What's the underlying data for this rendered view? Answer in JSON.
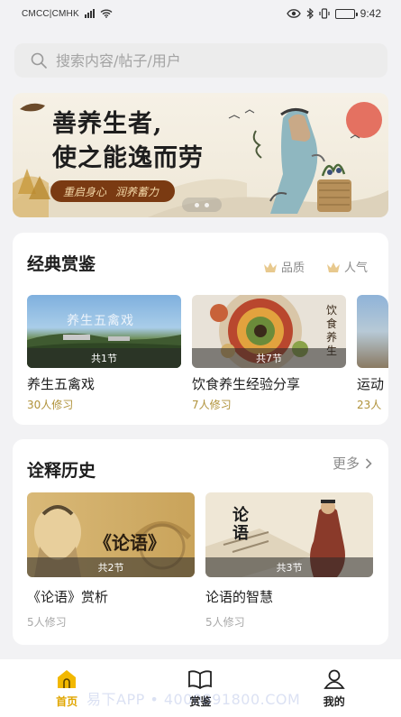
{
  "status": {
    "carrier": "CMCC|CMHK",
    "time": "9:42"
  },
  "search": {
    "placeholder": "搜索内容/帖子/用户"
  },
  "banner": {
    "title_line1": "善养生者,",
    "title_line2": "使之能逸而劳",
    "tag_left": "重启身心",
    "tag_right": "润养蓄力"
  },
  "classics": {
    "title": "经典赏鉴",
    "filters": [
      "品质",
      "人气"
    ],
    "items": [
      {
        "title": "养生五禽戏",
        "image_text": "养生五禽戏",
        "lessons": "共1节",
        "learners": "30人修习"
      },
      {
        "title": "饮食养生经验分享",
        "image_text": "饮食养生",
        "lessons": "共7节",
        "learners": "7人修习"
      },
      {
        "title": "运动",
        "lessons": "",
        "learners": "23人"
      }
    ]
  },
  "history": {
    "title": "诠释历史",
    "more": "更多",
    "items": [
      {
        "title": "《论语》赏析",
        "image_text": "《论语》",
        "lessons": "共2节",
        "learners": "5人修习"
      },
      {
        "title": "论语的智慧",
        "image_text": "论语",
        "lessons": "共3节",
        "learners": "5人修习"
      }
    ]
  },
  "tabbar": {
    "tabs": [
      {
        "label": "首页",
        "icon": "home-icon",
        "active": true
      },
      {
        "label": "赏鉴",
        "icon": "book-icon",
        "active": false
      },
      {
        "label": "我的",
        "icon": "user-icon",
        "active": false
      }
    ]
  },
  "watermark": "易下APP • 4000891800.COM",
  "colors": {
    "accent": "#e0a600",
    "banner_tag": "#7a3a12",
    "learners": "#b0923a"
  }
}
